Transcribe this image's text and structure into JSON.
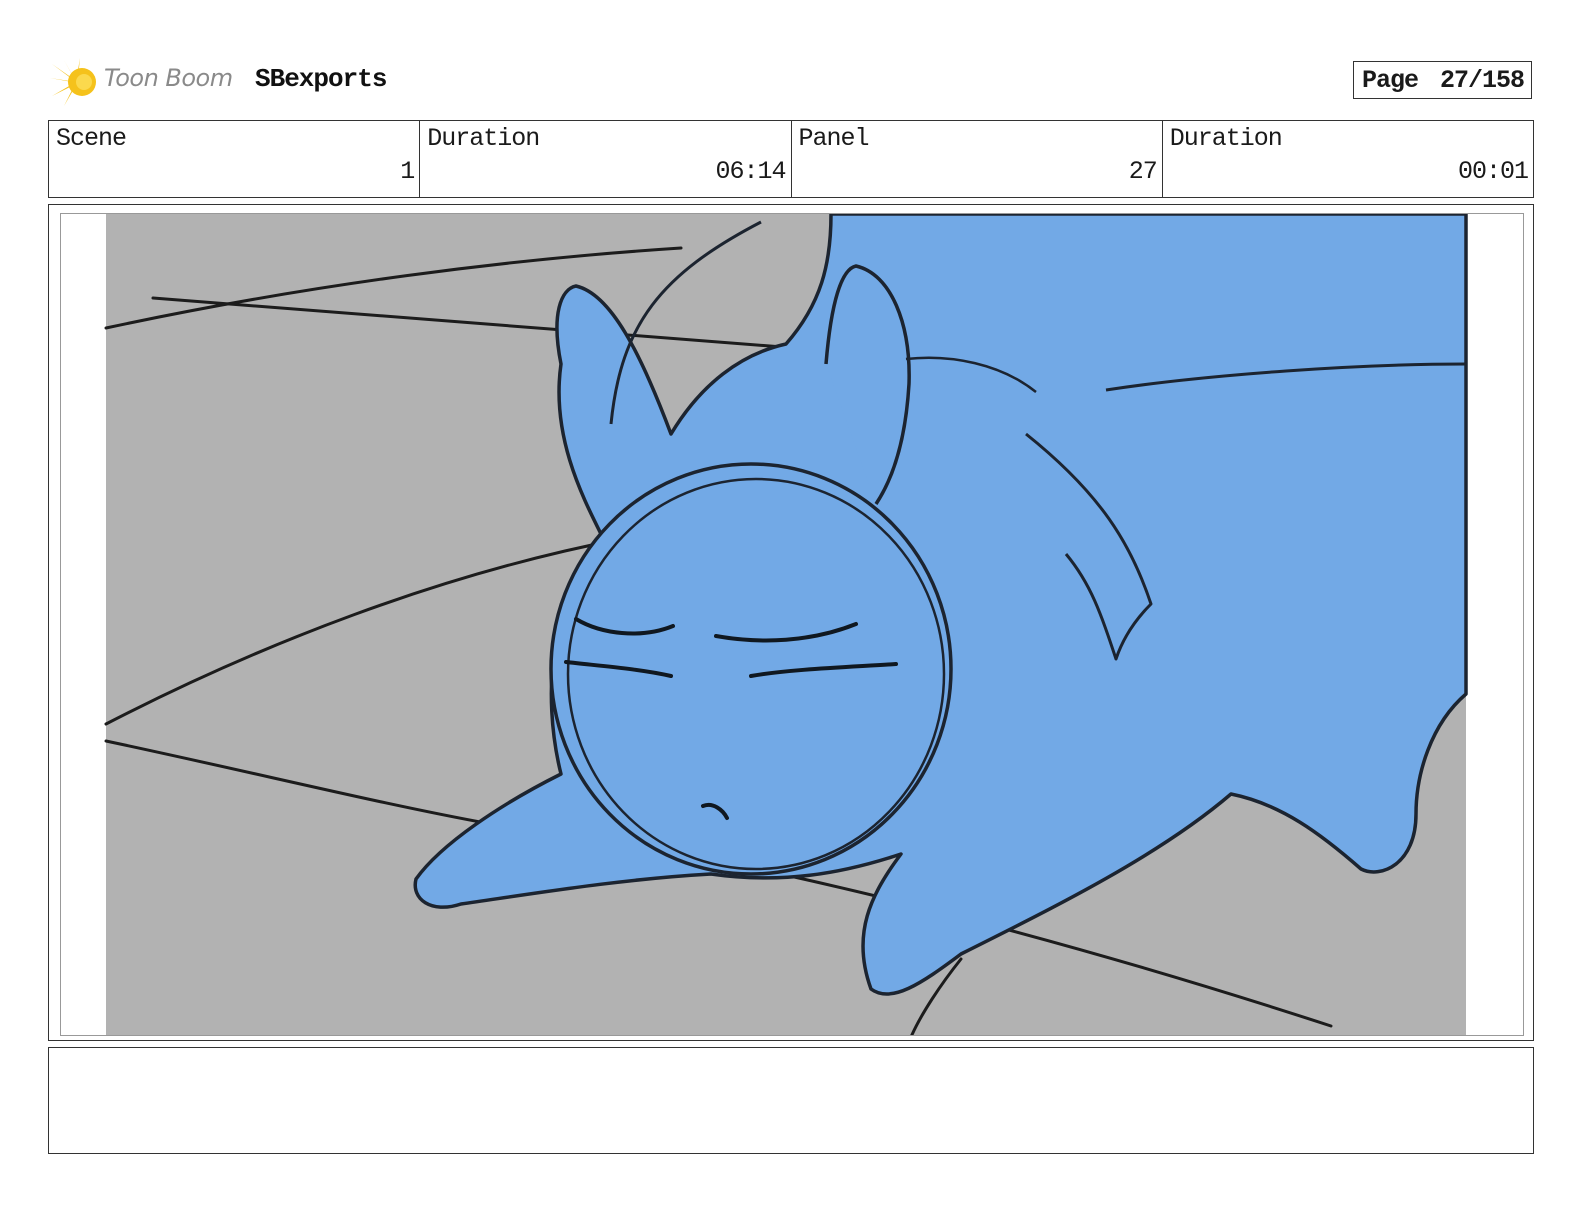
{
  "header": {
    "logo_text": "Toon Boom",
    "project_title": "SBexports",
    "page_label": "Page",
    "page_value": "27/158"
  },
  "info": {
    "scene_label": "Scene",
    "scene_value": "1",
    "scene_duration_label": "Duration",
    "scene_duration_value": "06:14",
    "panel_label": "Panel",
    "panel_value": "27",
    "panel_duration_label": "Duration",
    "panel_duration_value": "00:01"
  },
  "panel": {
    "caption": ""
  },
  "colors": {
    "floor": "#b2b2b2",
    "character_fill": "#72a9e6",
    "line": "#1c1c1c",
    "logo_yellow": "#f5c21b"
  }
}
